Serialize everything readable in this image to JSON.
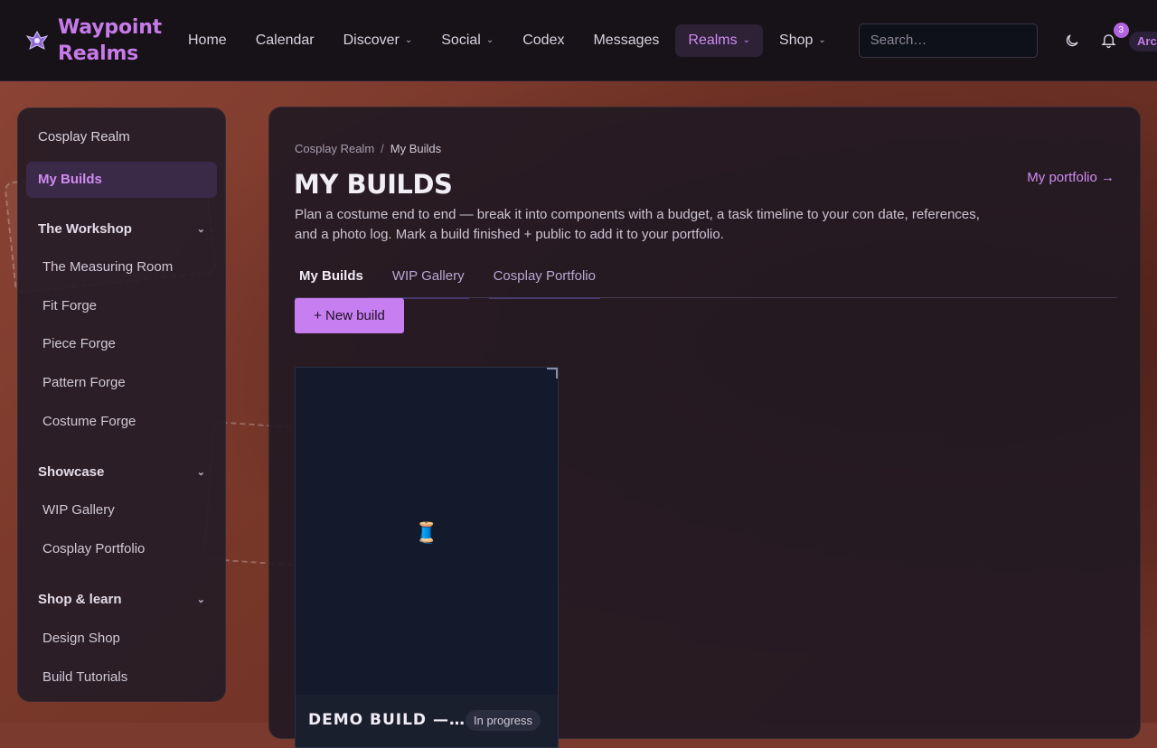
{
  "brand": {
    "name_line1": "Waypoint",
    "name_line2": "Realms"
  },
  "nav": {
    "items": [
      {
        "label": "Home",
        "dropdown": false
      },
      {
        "label": "Calendar",
        "dropdown": false
      },
      {
        "label": "Discover",
        "dropdown": true
      },
      {
        "label": "Social",
        "dropdown": true
      },
      {
        "label": "Codex",
        "dropdown": false
      },
      {
        "label": "Messages",
        "dropdown": false
      },
      {
        "label": "Realms",
        "dropdown": true,
        "active": true
      },
      {
        "label": "Shop",
        "dropdown": true
      }
    ],
    "search_placeholder": "Search…",
    "notification_count": "3",
    "user_label": "Arc"
  },
  "sidebar": {
    "realm_link": "Cosplay Realm",
    "active_item": "My Builds",
    "sections": [
      {
        "title": "The Workshop",
        "items": [
          "The Measuring Room",
          "Fit Forge",
          "Piece Forge",
          "Pattern Forge",
          "Costume Forge"
        ]
      },
      {
        "title": "Showcase",
        "items": [
          "WIP Gallery",
          "Cosplay Portfolio"
        ]
      },
      {
        "title": "Shop & learn",
        "items": [
          "Design Shop",
          "Build Tutorials"
        ]
      }
    ]
  },
  "main": {
    "breadcrumb": {
      "parent": "Cosplay Realm",
      "separator": "/",
      "current": "My Builds"
    },
    "title": "MY BUILDS",
    "portfolio_link": "My portfolio →",
    "description": "Plan a costume end to end — break it into components with a budget, a task timeline to your con date, references, and a photo log. Mark a build finished + public to add it to your portfolio.",
    "tabs": [
      "My Builds",
      "WIP Gallery",
      "Cosplay Portfolio"
    ],
    "new_button": "+ New build",
    "cards": [
      {
        "title": "DEMO BUILD —…",
        "status": "In progress",
        "thumb_icon": "🧵"
      }
    ]
  },
  "colors": {
    "accent": "#c77ef0",
    "topbar": "#171118",
    "background": "#7a3a2e"
  }
}
